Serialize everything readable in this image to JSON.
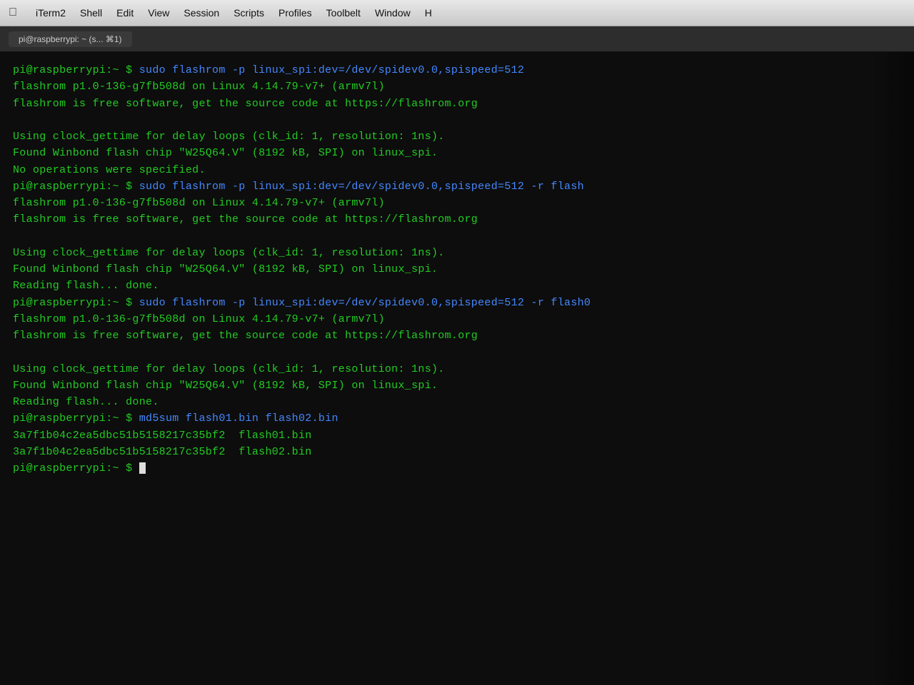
{
  "menubar": {
    "apple": "&#63743;",
    "items": [
      "iTerm2",
      "Shell",
      "Edit",
      "View",
      "Session",
      "Scripts",
      "Profiles",
      "Toolbelt",
      "Window",
      "H"
    ]
  },
  "tabbar": {
    "tab_label": "pi@raspberrypi: ~ (s...  ⌘1)"
  },
  "terminal": {
    "lines": [
      {
        "type": "prompt_cmd",
        "prompt": "pi@raspberrypi:~ $ ",
        "cmd": "sudo flashrom -p linux_spi:dev=/dev/spidev0.0,spispeed=512"
      },
      {
        "type": "output",
        "text": "flashrom p1.0-136-g7fb508d on Linux 4.14.79-v7+ (armv7l)"
      },
      {
        "type": "output",
        "text": "flashrom is free software, get the source code at https://flashrom.org"
      },
      {
        "type": "blank"
      },
      {
        "type": "output",
        "text": "Using clock_gettime for delay loops (clk_id: 1, resolution: 1ns)."
      },
      {
        "type": "output",
        "text": "Found Winbond flash chip \"W25Q64.V\" (8192 kB, SPI) on linux_spi."
      },
      {
        "type": "output",
        "text": "No operations were specified."
      },
      {
        "type": "prompt_cmd",
        "prompt": "pi@raspberrypi:~ $ ",
        "cmd": "sudo flashrom -p linux_spi:dev=/dev/spidev0.0,spispeed=512 -r flash"
      },
      {
        "type": "output",
        "text": "flashrom p1.0-136-g7fb508d on Linux 4.14.79-v7+ (armv7l)"
      },
      {
        "type": "output",
        "text": "flashrom is free software, get the source code at https://flashrom.org"
      },
      {
        "type": "blank"
      },
      {
        "type": "output",
        "text": "Using clock_gettime for delay loops (clk_id: 1, resolution: 1ns)."
      },
      {
        "type": "output",
        "text": "Found Winbond flash chip \"W25Q64.V\" (8192 kB, SPI) on linux_spi."
      },
      {
        "type": "output",
        "text": "Reading flash... done."
      },
      {
        "type": "prompt_cmd",
        "prompt": "pi@raspberrypi:~ $ ",
        "cmd": "sudo flashrom -p linux_spi:dev=/dev/spidev0.0,spispeed=512 -r flash0"
      },
      {
        "type": "output",
        "text": "flashrom p1.0-136-g7fb508d on Linux 4.14.79-v7+ (armv7l)"
      },
      {
        "type": "output",
        "text": "flashrom is free software, get the source code at https://flashrom.org"
      },
      {
        "type": "blank"
      },
      {
        "type": "output",
        "text": "Using clock_gettime for delay loops (clk_id: 1, resolution: 1ns)."
      },
      {
        "type": "output",
        "text": "Found Winbond flash chip \"W25Q64.V\" (8192 kB, SPI) on linux_spi."
      },
      {
        "type": "output",
        "text": "Reading flash... done."
      },
      {
        "type": "prompt_cmd",
        "prompt": "pi@raspberrypi:~ $ ",
        "cmd": "md5sum flash01.bin flash02.bin"
      },
      {
        "type": "output",
        "text": "3a7f1b04c2ea5dbc51b5158217c35bf2  flash01.bin"
      },
      {
        "type": "output",
        "text": "3a7f1b04c2ea5dbc51b5158217c35bf2  flash02.bin"
      },
      {
        "type": "prompt_cursor",
        "prompt": "pi@raspberrypi:~ $ "
      }
    ]
  }
}
